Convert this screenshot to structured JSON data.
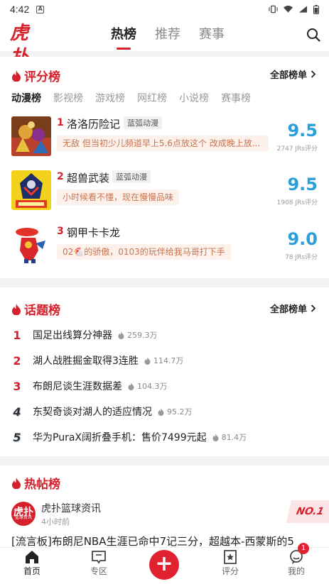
{
  "status": {
    "time": "4:42"
  },
  "header": {
    "logo": "虎扑",
    "tabs": [
      "热榜",
      "推荐",
      "赛事"
    ],
    "active_tab": 0
  },
  "rating": {
    "title": "评分榜",
    "more": "全部榜单",
    "subtabs": [
      "动漫榜",
      "影视榜",
      "游戏榜",
      "网红榜",
      "小说榜",
      "赛事榜"
    ],
    "items": [
      {
        "rank": "1",
        "name": "洛洛历险记",
        "tag": "蓝弧动漫",
        "comment": "无敌 但当初少儿频道早上5.6点放这个 改成晚上放...",
        "score": "9.5",
        "count": "2747 JRs评分"
      },
      {
        "rank": "2",
        "name": "超兽武装",
        "tag": "蓝弧动漫",
        "comment": "小时候看不懂，现在慢慢品味",
        "score": "9.5",
        "count": "1908 JRs评分"
      },
      {
        "rank": "3",
        "name": "钢甲卡卡龙",
        "tag": "",
        "comment": "02🐔的骄傲，0103的玩伴给我马哥打下手",
        "score": "9.0",
        "count": "78 JRs评分"
      }
    ]
  },
  "topics": {
    "title": "话题榜",
    "more": "全部榜单",
    "items": [
      {
        "rank": "1",
        "text": "国足出线算分神器",
        "heat": "259.3万"
      },
      {
        "rank": "2",
        "text": "湖人战胜掘金取得3连胜",
        "heat": "114.7万"
      },
      {
        "rank": "3",
        "text": "布朗尼谈生涯数据差",
        "heat": "104.3万"
      },
      {
        "rank": "4",
        "text": "东契奇谈对湖人的适应情况",
        "heat": "95.2万"
      },
      {
        "rank": "5",
        "text": "华为PuraX阔折叠手机：售价7499元起",
        "heat": "81.4万"
      }
    ]
  },
  "hotposts": {
    "title": "热帖榜",
    "author": "虎扑篮球资讯",
    "time": "4小时前",
    "avatar_text": "虎扑",
    "avatar_sub": "篮球资讯",
    "badge": "NO.1",
    "post": "[流言板]布朗尼NBA生涯已命中7记三分，超越本-西蒙斯的5"
  },
  "bottom_nav": {
    "items": [
      "首页",
      "专区",
      "",
      "评分",
      "我的"
    ],
    "badge": "1"
  }
}
